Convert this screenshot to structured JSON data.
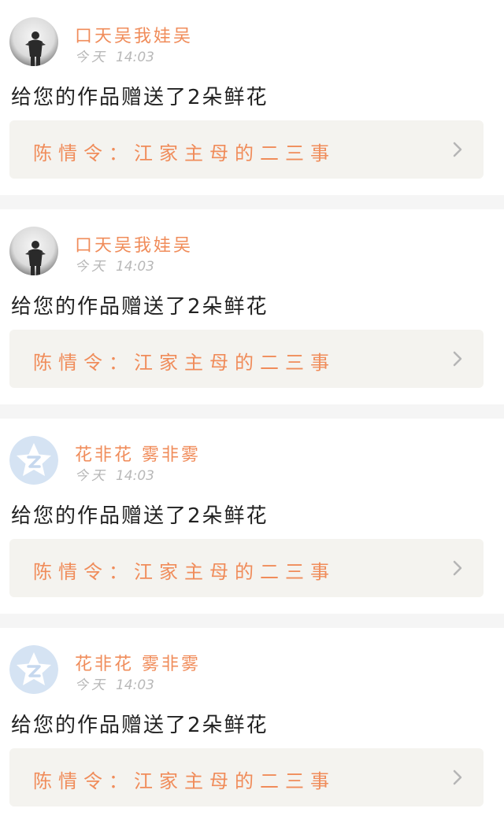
{
  "notifications": [
    {
      "username": "口天吴我娃吴",
      "avatar": "photo-avatar",
      "time_day": "今天",
      "time_clock": "14:03",
      "message": "给您的作品赠送了2朵鲜花",
      "work_title": "陈情令：江家主母的二三事"
    },
    {
      "username": "口天吴我娃吴",
      "avatar": "photo-avatar",
      "time_day": "今天",
      "time_clock": "14:03",
      "message": "给您的作品赠送了2朵鲜花",
      "work_title": "陈情令：江家主母的二三事"
    },
    {
      "username": "花非花 雾非雾",
      "avatar": "default-star-avatar",
      "time_day": "今天",
      "time_clock": "14:03",
      "message": "给您的作品赠送了2朵鲜花",
      "work_title": "陈情令：江家主母的二三事"
    },
    {
      "username": "花非花 雾非雾",
      "avatar": "default-star-avatar",
      "time_day": "今天",
      "time_clock": "14:03",
      "message": "给您的作品赠送了2朵鲜花",
      "work_title": "陈情令：江家主母的二三事"
    }
  ],
  "colors": {
    "accent": "#f08c5a",
    "time": "#b8b8b8",
    "text": "#222222",
    "link_bg": "#f4f3ef",
    "divider": "#f5f5f5",
    "chevron": "#b5b5b5"
  }
}
